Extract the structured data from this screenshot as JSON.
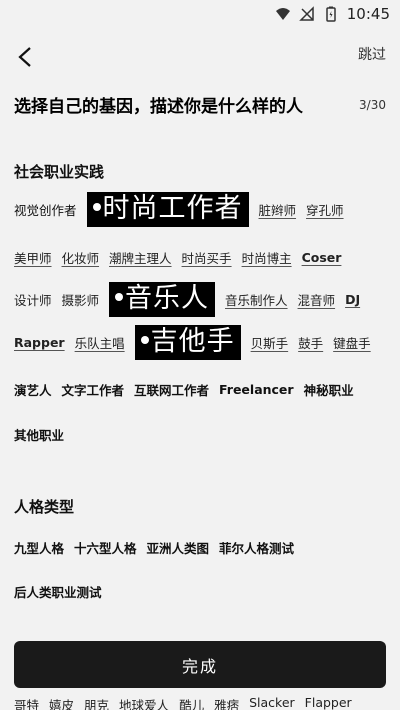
{
  "status_bar": {
    "time": "10:45"
  },
  "header": {
    "skip_label": "跳过"
  },
  "headline": "选择自己的基因，描述你是什么样的人",
  "counter": "3/30",
  "sections": [
    {
      "title": "社会职业实践",
      "rows": [
        [
          "视觉创作者",
          "时尚工作者",
          "脏辫师",
          "穿孔师"
        ],
        [
          "美甲师",
          "化妆师",
          "潮牌主理人",
          "时尚买手",
          "时尚博主",
          "Coser"
        ],
        [
          "设计师",
          "摄影师",
          "音乐人",
          "音乐制作人",
          "混音师",
          "DJ"
        ],
        [
          "Rapper",
          "乐队主唱",
          "吉他手",
          "贝斯手",
          "鼓手",
          "键盘手"
        ],
        [
          "演艺人",
          "文字工作者",
          "互联网工作者",
          "Freelancer",
          "神秘职业"
        ],
        [
          "其他职业"
        ]
      ]
    },
    {
      "title": "人格类型",
      "rows": [
        [
          "九型人格",
          "十六型人格",
          "亚洲人类图",
          "菲尔人格测试"
        ],
        [
          "后人类职业测试"
        ]
      ]
    }
  ],
  "done_label": "完成",
  "bottom_row": [
    "哥特",
    "嬉皮",
    "朋克",
    "地球爱人",
    "酷儿",
    "雅痞",
    "Slacker",
    "Flapper"
  ]
}
